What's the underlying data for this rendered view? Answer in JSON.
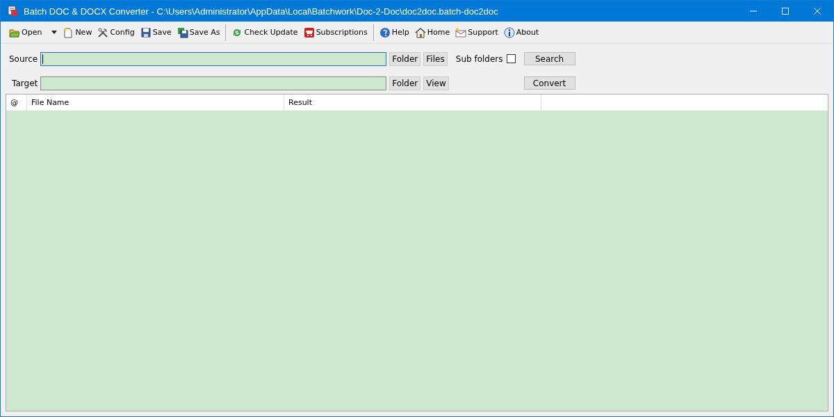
{
  "window": {
    "title": "Batch DOC & DOCX Converter - C:\\Users\\Administrator\\AppData\\Local\\Batchwork\\Doc-2-Doc\\doc2doc.batch-doc2doc"
  },
  "toolbar": [
    [
      {
        "label": "Open",
        "has_menu": true
      },
      {
        "label": "New",
        "has_menu": false
      },
      {
        "label": "Config",
        "has_menu": false
      },
      {
        "label": "Save",
        "has_menu": false
      },
      {
        "label": "Save As",
        "has_menu": false
      }
    ],
    [
      {
        "label": "Check Update",
        "has_menu": false
      },
      {
        "label": "Subscriptions",
        "has_menu": false
      }
    ],
    [
      {
        "label": "Help",
        "has_menu": false
      },
      {
        "label": "Home",
        "has_menu": false
      },
      {
        "label": "Support",
        "has_menu": false
      },
      {
        "label": "About",
        "has_menu": false
      }
    ]
  ],
  "source": {
    "label": "Source",
    "focused": true,
    "buttons": [
      "Folder",
      "Files"
    ]
  },
  "subfolders": {
    "label": "Sub folders",
    "checked": false
  },
  "search_button": "Search",
  "target": {
    "label": "Target",
    "focused": false,
    "buttons": [
      "Folder",
      "View"
    ]
  },
  "convert_button": "Convert",
  "table": {
    "columns": [
      "@",
      "File Name",
      "Result"
    ]
  }
}
